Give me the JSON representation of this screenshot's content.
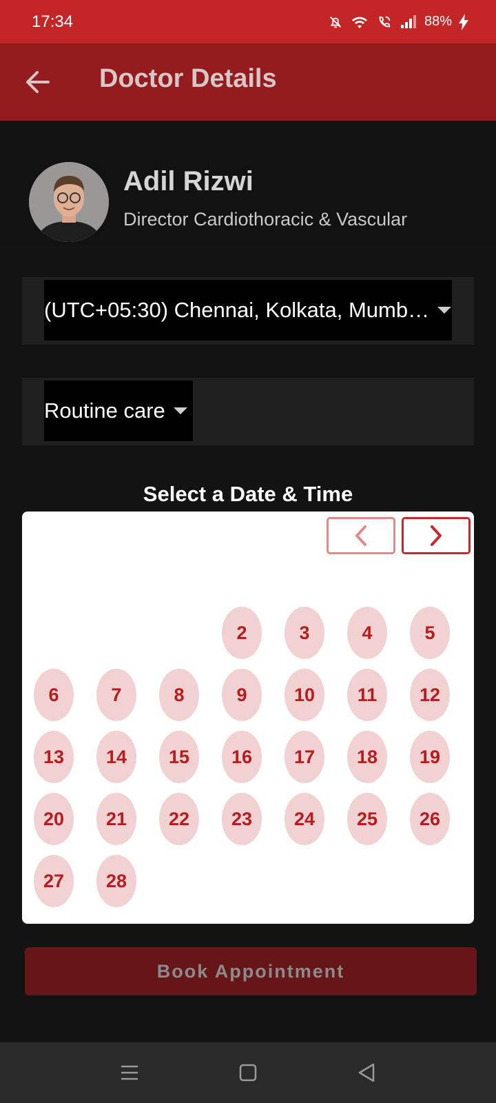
{
  "status_bar": {
    "time": "17:34",
    "battery": "88%",
    "icons": [
      "bell-muted-icon",
      "wifi-icon",
      "wifi-call-icon",
      "signal-icon",
      "charging-bolt-icon"
    ]
  },
  "app_bar": {
    "title": "Doctor Details",
    "back_icon": "arrow-left-icon"
  },
  "doctor": {
    "name": "Adil Rizwi",
    "title": "Director Cardiothoracic & Vascular"
  },
  "timezone_select": {
    "selected": "(UTC+05:30) Chennai, Kolkata, Mumb…"
  },
  "care_select": {
    "selected": "Routine care"
  },
  "calendar": {
    "heading": "Select a Date & Time",
    "prev_icon": "chevron-left-icon",
    "next_icon": "chevron-right-icon",
    "days": [
      "2",
      "3",
      "4",
      "5",
      "6",
      "7",
      "8",
      "9",
      "10",
      "11",
      "12",
      "13",
      "14",
      "15",
      "16",
      "17",
      "18",
      "19",
      "20",
      "21",
      "22",
      "23",
      "24",
      "25",
      "26",
      "27",
      "28"
    ]
  },
  "book_button": {
    "label": "Book Appointment"
  },
  "colors": {
    "status_bar": "#c42628",
    "app_bar": "#941c1e",
    "day_bg": "#f2d1d2",
    "day_text": "#b71c1e",
    "book_bg": "#661619"
  }
}
